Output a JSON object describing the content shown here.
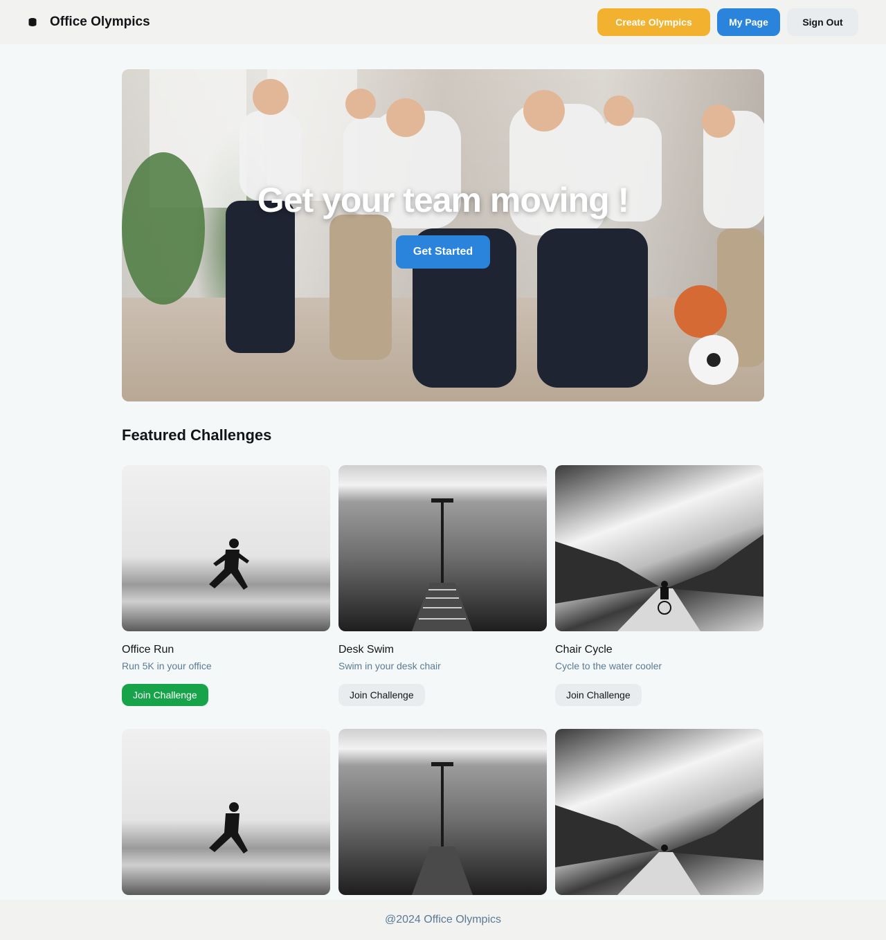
{
  "header": {
    "brand": "Office Olympics",
    "brand_icon": "logo-icon",
    "create_label": "Create Olympics",
    "mypage_label": "My Page",
    "signout_label": "Sign Out",
    "colors": {
      "create": "#f2b12e",
      "mypage": "#2b84dc",
      "signout": "#e8ecef"
    }
  },
  "hero": {
    "title": "Get your team moving !",
    "cta_label": "Get Started"
  },
  "featured": {
    "title": "Featured Challenges",
    "cards": [
      {
        "title": "Office Run",
        "desc": "Run 5K in your office",
        "button": "Join Challenge",
        "image": "runner-image",
        "highlighted": true
      },
      {
        "title": "Desk Swim",
        "desc": "Swim in your desk chair",
        "button": "Join Challenge",
        "image": "pier-image",
        "highlighted": false
      },
      {
        "title": "Chair Cycle",
        "desc": "Cycle to the water cooler",
        "button": "Join Challenge",
        "image": "cyclist-image",
        "highlighted": false
      }
    ],
    "row2_images": [
      "runner-image",
      "pier-image",
      "cyclist-image"
    ]
  },
  "footer": {
    "text": "@2024 Office Olympics"
  },
  "colors": {
    "accent_green": "#17a34a",
    "muted_text": "#5a7a95"
  }
}
